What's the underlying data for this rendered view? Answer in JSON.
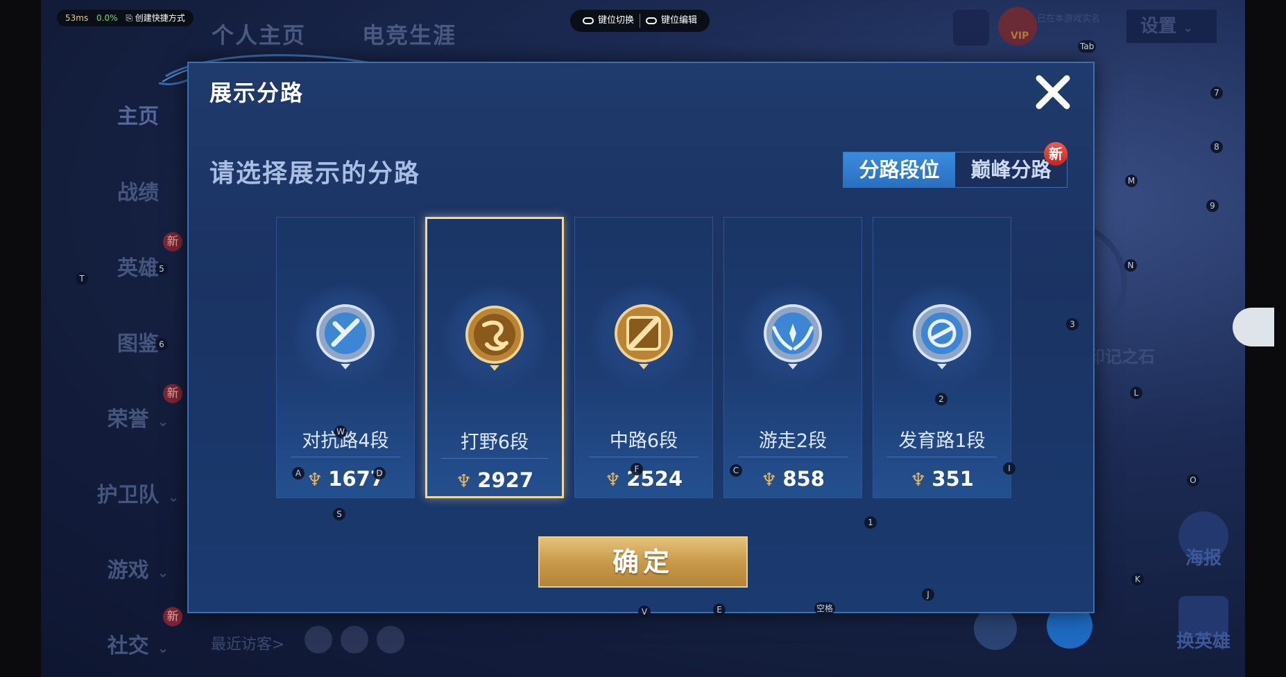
{
  "status_bar": {
    "latency": "53ms",
    "loss": "0.0%",
    "shortcut": "创建快捷方式"
  },
  "key_toolbar": {
    "switch": "键位切换",
    "edit": "键位编辑"
  },
  "background": {
    "tabs": [
      "个人主页",
      "电竞生涯"
    ],
    "sidebar": [
      "主页",
      "战绩",
      "英雄",
      "图鉴",
      "荣誉",
      "护卫队",
      "游戏",
      "社交"
    ],
    "new_badge": "新",
    "settings": "设置",
    "vip": "VIP",
    "notice": "已在本游戏实名",
    "recent_visitors": "最近访客>",
    "right_text": "印记之石",
    "poster": "海报",
    "change_hero": "换英雄"
  },
  "modal": {
    "title": "展示分路",
    "prompt": "请选择展示的分路",
    "tabs": [
      {
        "label": "分路段位",
        "active": true
      },
      {
        "label": "巅峰分路",
        "active": false
      }
    ],
    "tab_badge": "新",
    "confirm": "确定",
    "cards": [
      {
        "name": "对抗路4段",
        "score": "1677",
        "emblem": "clash-lane-emblem-icon",
        "tier": "silver",
        "selected": false
      },
      {
        "name": "打野6段",
        "score": "2927",
        "emblem": "jungle-dragon-emblem-icon",
        "tier": "gold",
        "selected": true
      },
      {
        "name": "中路6段",
        "score": "2524",
        "emblem": "mid-lane-emblem-icon",
        "tier": "gold",
        "selected": false
      },
      {
        "name": "游走2段",
        "score": "858",
        "emblem": "roam-wings-emblem-icon",
        "tier": "silver",
        "selected": false
      },
      {
        "name": "发育路1段",
        "score": "351",
        "emblem": "farm-lane-emblem-icon",
        "tier": "silver",
        "selected": false
      }
    ]
  },
  "key_hints": [
    "Tab",
    "7",
    "8",
    "M",
    "9",
    "N",
    "3",
    "5",
    "T",
    "6",
    "W",
    "A",
    "D",
    "F",
    "C",
    "I",
    "2",
    "S",
    "1",
    "O",
    "L",
    "K",
    "J",
    "V",
    "E",
    "空格"
  ],
  "colors": {
    "accent_blue": "#2a6fc0",
    "gold": "#e5c27b",
    "selected_border": "#f2d79b"
  }
}
